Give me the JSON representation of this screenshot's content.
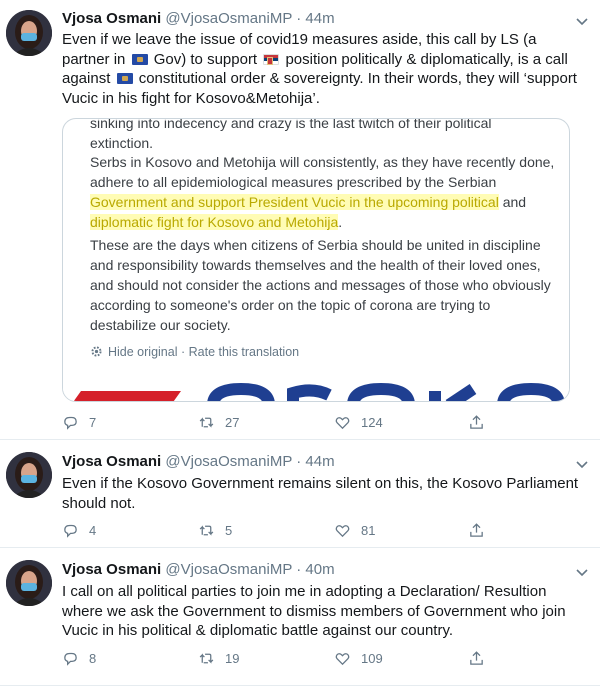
{
  "tweets": [
    {
      "name": "Vjosa Osmani",
      "handle": "@VjosaOsmaniMP",
      "time": "44m",
      "text_1": "Even if we leave the issue of covid19 measures aside, this call by LS (a partner in",
      "text_2": "Gov) to support",
      "text_3": "position politically & diplomatically, is a call against",
      "text_4": "constitutional order & sovereignty. In their words, they will ‘support Vucic in his fight for Kosovo&Metohija’.",
      "flag_kosovo": "kosovo-flag-icon",
      "flag_serbia": "serbia-flag-icon",
      "quoted": {
        "line_cut": "sinking into indecency and crazy is the last twitch of their political",
        "line_cut_2": "extinction.",
        "p2_a": "Serbs in Kosovo and Metohija will consistently, as they have recently done, adhere to all epidemiological measures prescribed by the Serbian ",
        "p2_hl": "Government and support President Vucic in the upcoming political",
        "p2_b": " and ",
        "p2_hl2": "diplomatic fight for Kosovo and Metohija",
        "p2_c": ".",
        "p3": "These are the days when citizens of Serbia should be united in discipline and responsibility towards themselves and the health of their loved ones, and should not consider the actions and messages of those who obviously according to someone's order on the topic of corona are trying to destabilize our society.",
        "hide_original": "Hide original",
        "separator": "·",
        "rate_translation": "Rate this translation"
      },
      "replies": "7",
      "retweets": "27",
      "likes": "124"
    },
    {
      "name": "Vjosa Osmani",
      "handle": "@VjosaOsmaniMP",
      "time": "44m",
      "text": "Even if the Kosovo Government remains silent on this, the Kosovo Parliament should not.",
      "replies": "4",
      "retweets": "5",
      "likes": "81"
    },
    {
      "name": "Vjosa Osmani",
      "handle": "@VjosaOsmaniMP",
      "time": "40m",
      "text": "I call on all political parties to join me in adopting a Declaration/ Resultion where we ask the Government to dismiss members of Government who join Vucic in his political & diplomatic battle against our country.",
      "replies": "8",
      "retweets": "19",
      "likes": "109"
    }
  ],
  "colors": {
    "text": "#14171a",
    "secondary": "#657786",
    "highlight": "#c8bd21",
    "border": "#e6ecf0"
  }
}
